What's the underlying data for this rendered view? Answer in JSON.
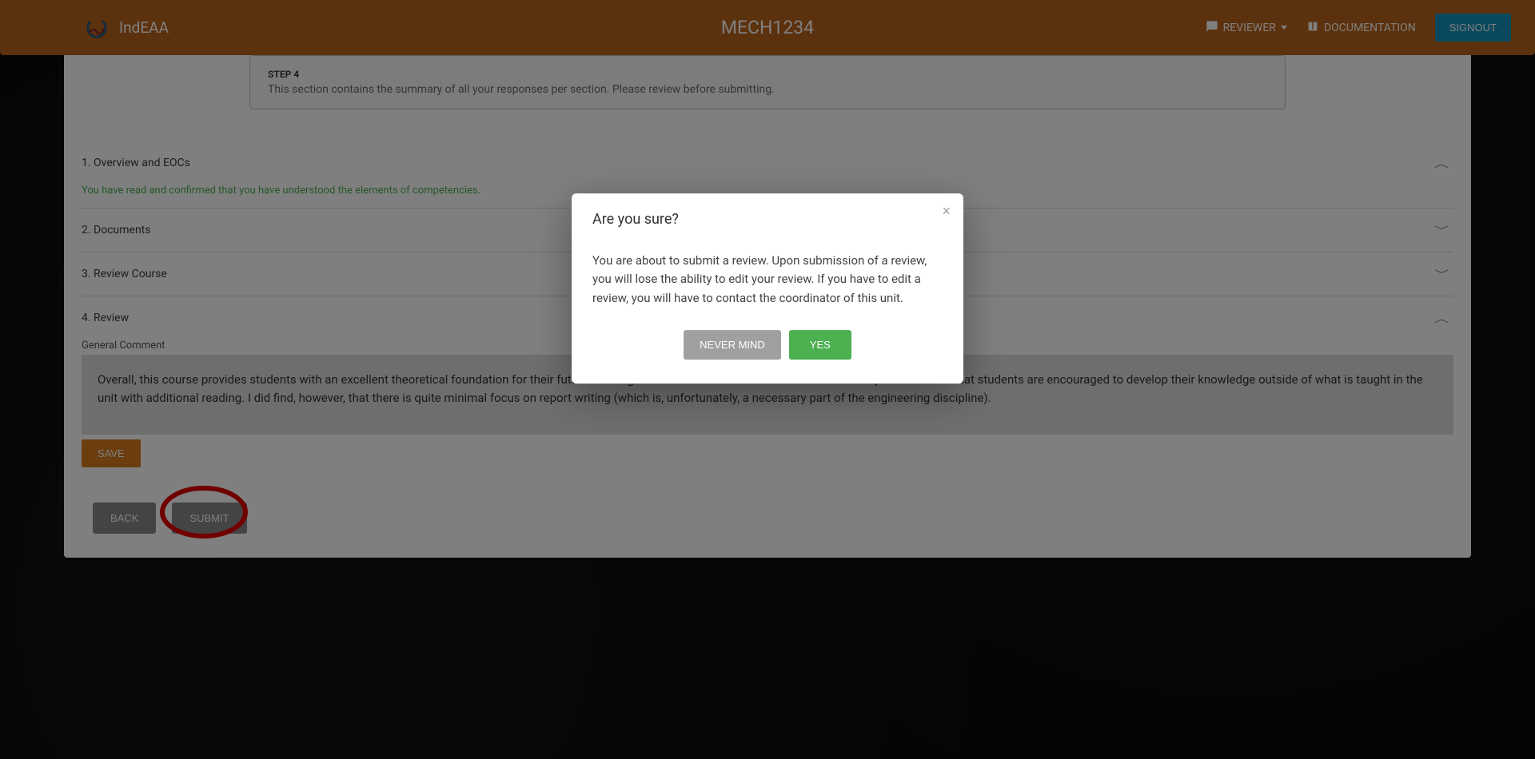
{
  "header": {
    "app_name": "IndEAA",
    "page_title": "MECH1234",
    "reviewer_label": "REVIEWER",
    "documentation_label": "DOCUMENTATION",
    "signout_label": "SIGNOUT"
  },
  "step": {
    "label": "STEP 4",
    "description": "This section contains the summary of all your responses per section. Please review before submitting."
  },
  "accordion": {
    "section1": {
      "title": "1. Overview and EOCs",
      "confirm_text": "You have read and confirmed that you have understood the elements of competencies."
    },
    "section2": {
      "title": "2. Documents"
    },
    "section3": {
      "title": "3. Review Course"
    },
    "section4": {
      "title": "4. Review",
      "gc_label": "General Comment",
      "gc_text": "Overall, this course provides students with an excellent theoretical foundation for their future learning and careers. The tests and exams also clearly demonstrate that students are encouraged to develop their knowledge outside of what is taught in the unit with additional reading. I did find, however, that there is quite minimal focus on report writing (which is, unfortunately, a necessary part of the engineering discipline).",
      "save_label": "SAVE"
    }
  },
  "bottom": {
    "back_label": "BACK",
    "submit_label": "SUBMIT"
  },
  "modal": {
    "title": "Are you sure?",
    "body": "You are about to submit a review. Upon submission of a review, you will lose the ability to edit your review. If you have to edit a review, you will have to contact the coordinator of this unit.",
    "never_mind": "NEVER MIND",
    "yes": "YES"
  }
}
